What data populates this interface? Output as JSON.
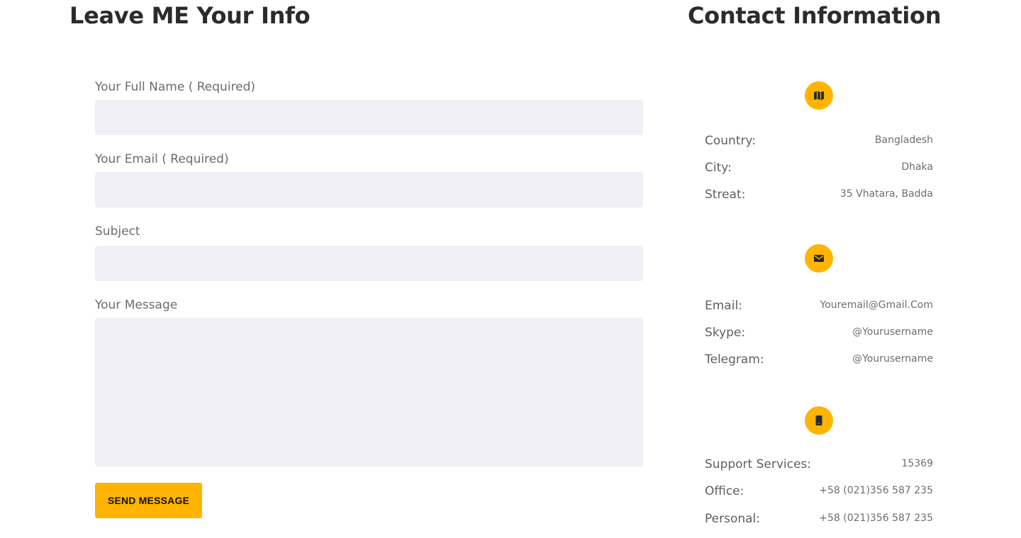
{
  "form": {
    "title": "Leave ME Your Info",
    "fields": [
      {
        "label": "Your Full Name ( Required)",
        "value": "",
        "placeholder": ""
      },
      {
        "label": "Your Email ( Required)",
        "value": "",
        "placeholder": ""
      },
      {
        "label": "Subject",
        "value": "",
        "placeholder": ""
      },
      {
        "label": "Your Message",
        "value": "",
        "placeholder": ""
      }
    ],
    "submit_label": "SEND MESSAGE"
  },
  "contact": {
    "title": "Contact Information",
    "groups": [
      {
        "icon": "map-icon",
        "rows": [
          {
            "key": "Country:",
            "value": "Bangladesh"
          },
          {
            "key": "City:",
            "value": "Dhaka"
          },
          {
            "key": "Streat:",
            "value": "35 Vhatara, Badda"
          }
        ]
      },
      {
        "icon": "envelope-icon",
        "rows": [
          {
            "key": "Email:",
            "value": "Youremail@Gmail.Com"
          },
          {
            "key": "Skype:",
            "value": "@Yourusername"
          },
          {
            "key": "Telegram:",
            "value": "@Yourusername"
          }
        ]
      },
      {
        "icon": "phone-icon",
        "rows": [
          {
            "key": "Support Services:",
            "value": "15369"
          },
          {
            "key": "Office:",
            "value": "+58 (021)356 587 235"
          },
          {
            "key": "Personal:",
            "value": "+58 (021)356 587 235"
          }
        ]
      }
    ]
  },
  "colors": {
    "accent": "#ffb400",
    "field_bg": "#f0eff5",
    "heading": "#2b2b2b",
    "label": "#6c6c6c"
  }
}
